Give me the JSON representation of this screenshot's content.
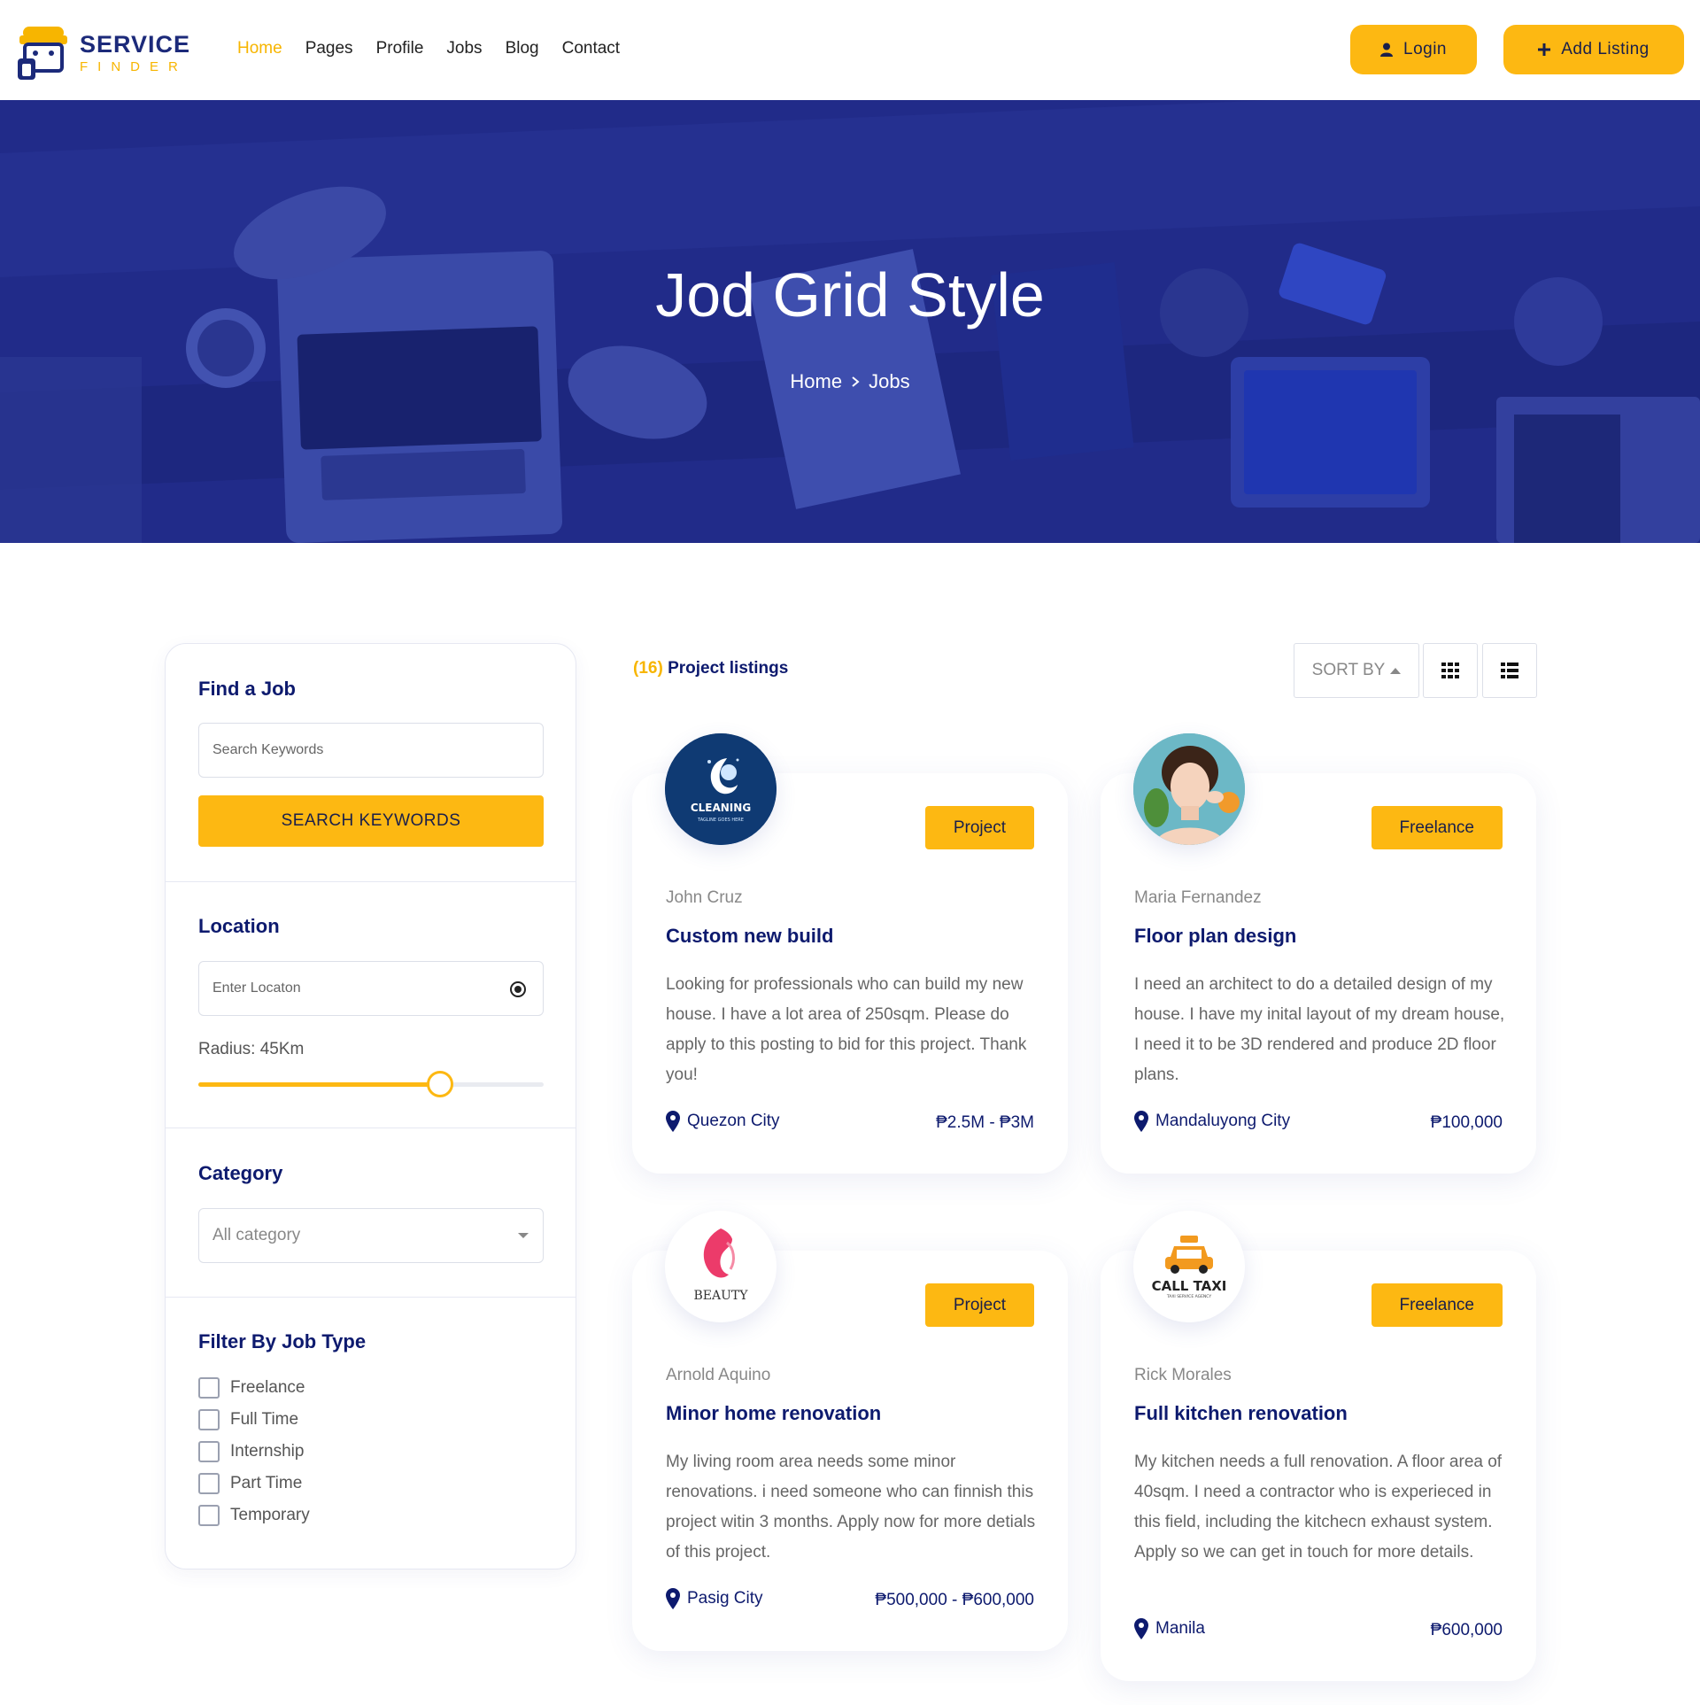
{
  "brand": {
    "name_line1": "SERVICE",
    "name_line2": "FINDER",
    "primary_color": "#1c2a7a",
    "accent_color": "#fdb812"
  },
  "nav": {
    "items": [
      {
        "label": "Home",
        "active": true
      },
      {
        "label": "Pages",
        "active": false
      },
      {
        "label": "Profile",
        "active": false
      },
      {
        "label": "Jobs",
        "active": false
      },
      {
        "label": "Blog",
        "active": false
      },
      {
        "label": "Contact",
        "active": false
      }
    ],
    "login_label": "Login",
    "login_icon": "user-icon",
    "add_listing_label": "Add Listing",
    "add_listing_icon": "plus-icon"
  },
  "hero": {
    "title": "Jod Grid Style",
    "breadcrumb": [
      "Home",
      "Jobs"
    ]
  },
  "sidebar": {
    "find_job": {
      "heading": "Find a Job",
      "search_placeholder": "Search Keywords",
      "button_label": "SEARCH KEYWORDS"
    },
    "location": {
      "heading": "Location",
      "placeholder": "Enter Locaton",
      "radius_label": "Radius: 45Km",
      "radius_fraction": 0.7
    },
    "category": {
      "heading": "Category",
      "selected": "All category"
    },
    "job_type": {
      "heading": "Filter By Job Type",
      "options": [
        {
          "label": "Freelance",
          "checked": false
        },
        {
          "label": "Full Time",
          "checked": false
        },
        {
          "label": "Internship",
          "checked": false
        },
        {
          "label": "Part Time",
          "checked": false
        },
        {
          "label": "Temporary",
          "checked": false
        }
      ]
    }
  },
  "listing": {
    "count": "(16)",
    "label": "Project listings",
    "sort_label": "SORT BY",
    "cards": [
      {
        "logo_text": "CLEANING",
        "logo_subtext": "TAGLINE GOES HERE",
        "badge": "Project",
        "author": "John Cruz",
        "title": "Custom new build",
        "description": "Looking for professionals who can build my new house. I have a lot area of 250sqm. Please do apply to this posting to bid for this project. Thank you!",
        "location": "Quezon City",
        "price": "₱2.5M - ₱3M"
      },
      {
        "logo_text": "",
        "logo_subtext": "",
        "badge": "Freelance",
        "author": "Maria Fernandez",
        "title": "Floor plan design",
        "description": "I need an architect to do a detailed design of my house. I have my inital layout of my dream house, I need it to be 3D rendered and produce 2D floor plans.",
        "location": "Mandaluyong City",
        "price": "₱100,000"
      },
      {
        "logo_text": "BEAUTY",
        "logo_subtext": "",
        "badge": "Project",
        "author": "Arnold Aquino",
        "title": "Minor home renovation",
        "description": "My living room area needs some minor renovations. i need someone who can finnish this project witin 3 months. Apply now for more detials of this project.",
        "location": "Pasig City",
        "price": "₱500,000 - ₱600,000"
      },
      {
        "logo_text": "CALL TAXI",
        "logo_subtext": "TAXI SERVICE AGENCY",
        "badge": "Freelance",
        "author": "Rick Morales",
        "title": "Full kitchen renovation",
        "description": "My kitchen needs a full renovation. A floor area of 40sqm. I need a contractor who is experieced in this field, including the kitchecn exhaust system. Apply so we can get in touch for more details.",
        "location": "Manila",
        "price": "₱600,000"
      }
    ]
  }
}
